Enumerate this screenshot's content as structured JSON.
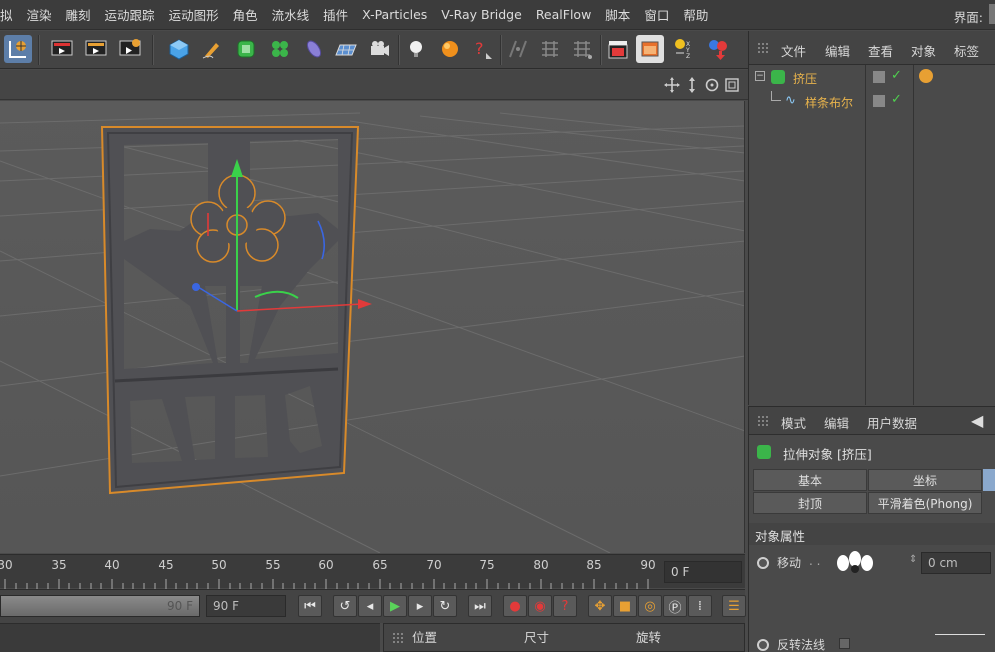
{
  "menubar": {
    "items": [
      "拟",
      "渲染",
      "雕刻",
      "运动跟踪",
      "运动图形",
      "角色",
      "流水线",
      "插件",
      "X-Particles",
      "V-Ray Bridge",
      "RealFlow",
      "脚本",
      "窗口",
      "帮助"
    ],
    "layout_label": "界面:"
  },
  "object_manager": {
    "menu": [
      "文件",
      "编辑",
      "查看",
      "对象",
      "标签"
    ],
    "objects": [
      {
        "name": "挤压",
        "icon": "extrude-icon"
      },
      {
        "name": "样条布尔",
        "icon": "spline-boolean-icon"
      }
    ]
  },
  "attribute_manager": {
    "menu": [
      "模式",
      "编辑",
      "用户数据"
    ],
    "title": "拉伸对象 [挤压]",
    "tabs": [
      "基本",
      "坐标",
      "封顶",
      "平滑着色(Phong)"
    ],
    "section": "对象属性",
    "move_label": "移动",
    "move_value": "0 cm",
    "reverse_normals_label": "反转法线"
  },
  "timeline": {
    "ticks": [
      "30",
      "35",
      "40",
      "45",
      "50",
      "55",
      "60",
      "65",
      "70",
      "75",
      "80",
      "85",
      "90"
    ],
    "current_frame": "0 F"
  },
  "transport": {
    "end_frame_slider": "90 F",
    "end_frame_field": "90 F"
  },
  "coordinates": {
    "position_label": "位置",
    "size_label": "尺寸",
    "rotation_label": "旋转"
  },
  "colors": {
    "accent_orange": "#e8a033",
    "object_name": "#e8b34c",
    "axis_x": "#e23a3a",
    "axis_y": "#3ad14a",
    "axis_z": "#3a66e2"
  }
}
